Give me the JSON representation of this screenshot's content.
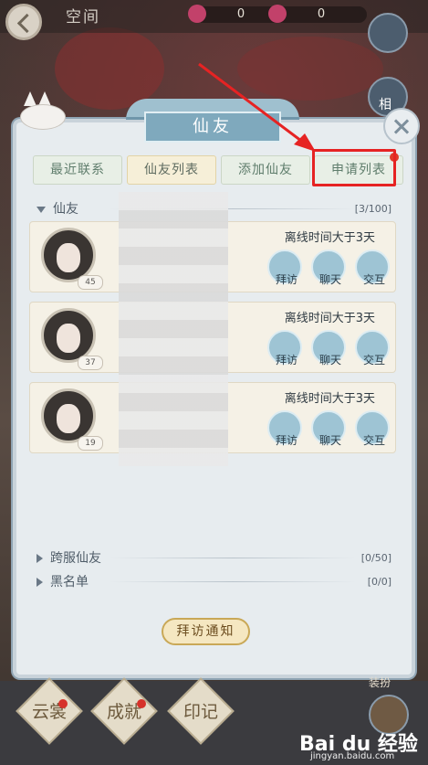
{
  "topbar": {
    "title": "空间",
    "resources": [
      {
        "value": "0"
      },
      {
        "value": "0"
      }
    ]
  },
  "dialog": {
    "title": "仙友",
    "tabs": [
      {
        "label": "最近联系"
      },
      {
        "label": "仙友列表"
      },
      {
        "label": "添加仙友"
      },
      {
        "label": "申请列表"
      }
    ],
    "friends_section": {
      "label": "仙友",
      "count": "[3/100]"
    },
    "friends": [
      {
        "level": "45",
        "status": "离线时间大于3天"
      },
      {
        "level": "37",
        "status": "离线时间大于3天"
      },
      {
        "level": "19",
        "status": "离线时间大于3天"
      }
    ],
    "actions": {
      "visit": "拜访",
      "chat": "聊天",
      "interact": "交互"
    },
    "cross_server": {
      "label": "跨服仙友",
      "count": "[0/50]"
    },
    "blacklist": {
      "label": "黑名单",
      "count": "[0/0]"
    },
    "visit_notice_button": "拜访通知"
  },
  "side": {
    "album_label": "相",
    "dress_label": "装扮"
  },
  "bottom_bar": {
    "items": [
      {
        "label": "云裳"
      },
      {
        "label": "成就"
      },
      {
        "label": "印记"
      }
    ]
  },
  "watermark": {
    "brand": "Bai du 经验",
    "url": "jingyan.baidu.com"
  },
  "colors": {
    "highlight": "#e62323",
    "badge": "#e03a2a",
    "panel": "#e7ecef",
    "accent": "#7fa9bd"
  }
}
